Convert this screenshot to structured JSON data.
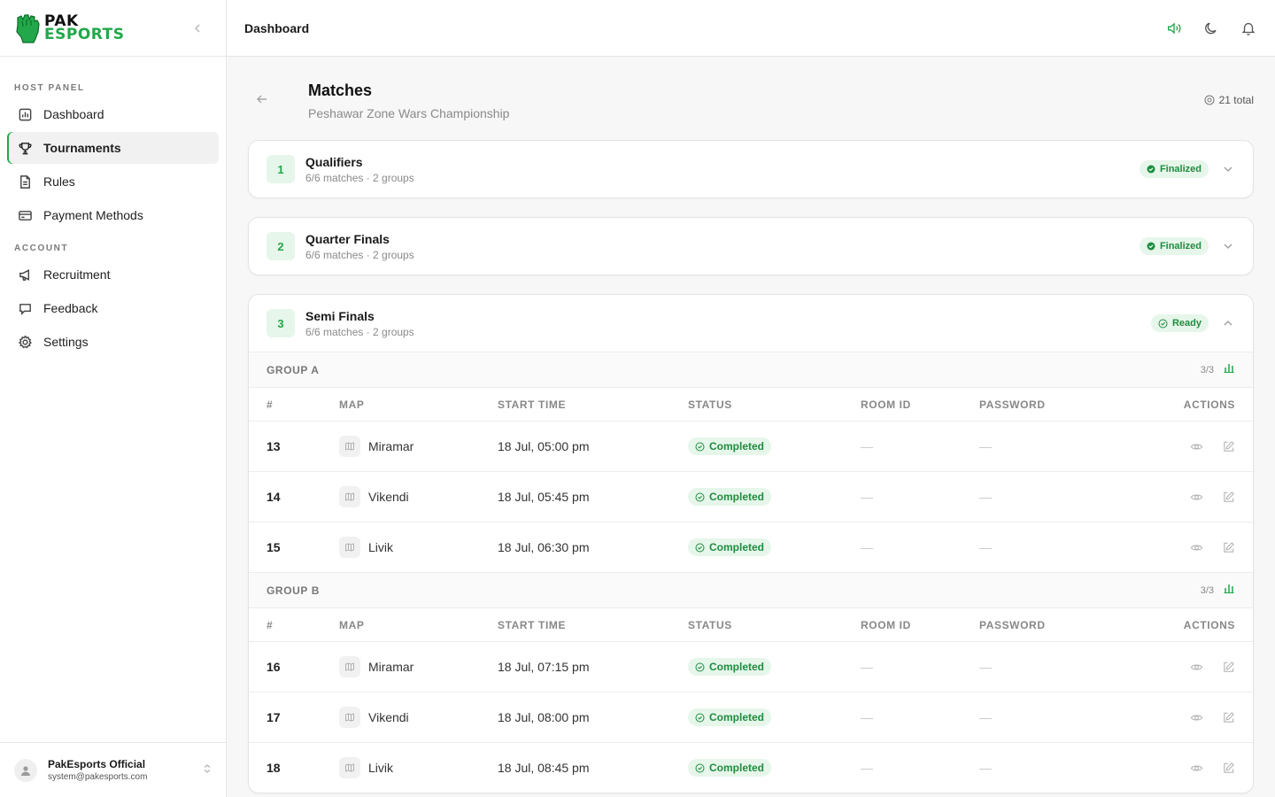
{
  "brand": {
    "line1": "PAK",
    "line2": "ESPORTS"
  },
  "sidebar": {
    "sections": [
      {
        "label": "HOST PANEL"
      },
      {
        "label": "ACCOUNT"
      }
    ],
    "items": [
      {
        "label": "Dashboard",
        "icon": "chart-icon"
      },
      {
        "label": "Tournaments",
        "icon": "trophy-icon",
        "active": true
      },
      {
        "label": "Rules",
        "icon": "document-icon"
      },
      {
        "label": "Payment Methods",
        "icon": "card-icon"
      },
      {
        "label": "Recruitment",
        "icon": "megaphone-icon"
      },
      {
        "label": "Feedback",
        "icon": "chat-icon"
      },
      {
        "label": "Settings",
        "icon": "gear-icon"
      }
    ],
    "user": {
      "name": "PakEsports Official",
      "email": "system@pakesports.com"
    }
  },
  "topbar": {
    "title": "Dashboard"
  },
  "page": {
    "title": "Matches",
    "subtitle": "Peshawar Zone Wars Championship",
    "total": "21 total"
  },
  "stages": [
    {
      "num": "1",
      "name": "Qualifiers",
      "meta": "6/6 matches · 2 groups",
      "status": "Finalized"
    },
    {
      "num": "2",
      "name": "Quarter Finals",
      "meta": "6/6 matches · 2 groups",
      "status": "Finalized"
    },
    {
      "num": "3",
      "name": "Semi Finals",
      "meta": "6/6 matches · 2 groups",
      "status": "Ready"
    }
  ],
  "columns": {
    "num": "#",
    "map": "MAP",
    "time": "START TIME",
    "status": "STATUS",
    "room": "ROOM ID",
    "password": "PASSWORD",
    "actions": "ACTIONS"
  },
  "groups": [
    {
      "title": "GROUP A",
      "count": "3/3",
      "matches": [
        {
          "num": "13",
          "map": "Miramar",
          "time": "18 Jul, 05:00 pm",
          "status": "Completed",
          "room": "—",
          "password": "—"
        },
        {
          "num": "14",
          "map": "Vikendi",
          "time": "18 Jul, 05:45 pm",
          "status": "Completed",
          "room": "—",
          "password": "—"
        },
        {
          "num": "15",
          "map": "Livik",
          "time": "18 Jul, 06:30 pm",
          "status": "Completed",
          "room": "—",
          "password": "—"
        }
      ]
    },
    {
      "title": "GROUP B",
      "count": "3/3",
      "matches": [
        {
          "num": "16",
          "map": "Miramar",
          "time": "18 Jul, 07:15 pm",
          "status": "Completed",
          "room": "—",
          "password": "—"
        },
        {
          "num": "17",
          "map": "Vikendi",
          "time": "18 Jul, 08:00 pm",
          "status": "Completed",
          "room": "—",
          "password": "—"
        },
        {
          "num": "18",
          "map": "Livik",
          "time": "18 Jul, 08:45 pm",
          "status": "Completed",
          "room": "—",
          "password": "—"
        }
      ]
    }
  ],
  "colors": {
    "accent": "#22a84a",
    "badge_bg": "#e6f6ea"
  }
}
